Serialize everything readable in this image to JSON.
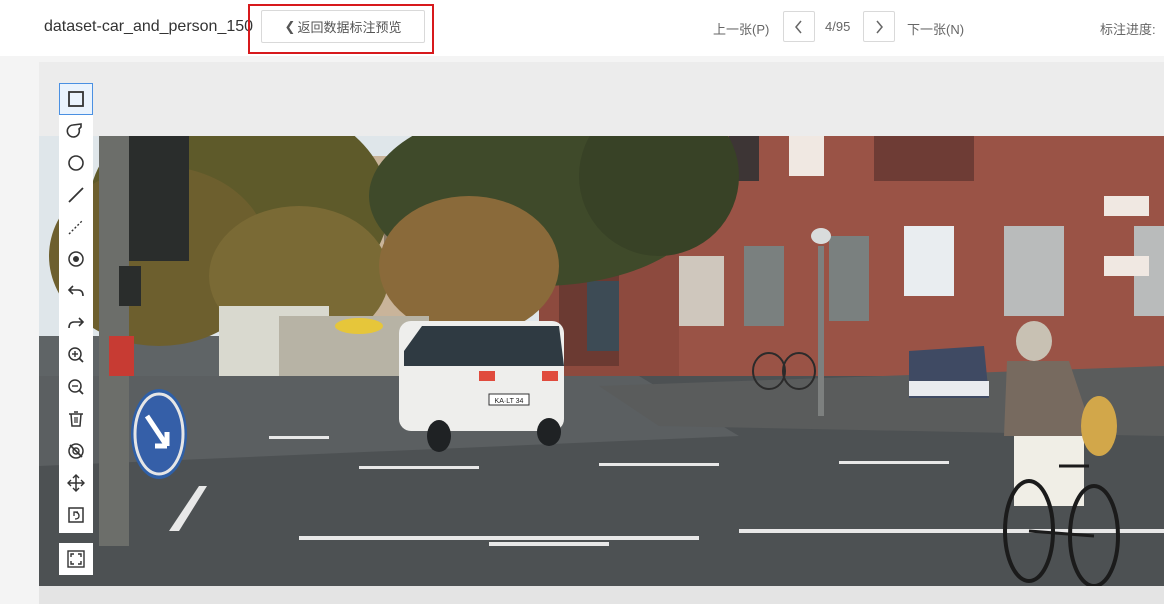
{
  "header": {
    "dataset_title": "dataset-car_and_person_150",
    "back_button_label": "返回数据标注预览",
    "prev_label": "上一张(P)",
    "next_label": "下一张(N)",
    "page_indicator": "4/95",
    "progress_label": "标注进度:"
  },
  "toolbar": {
    "tools": [
      {
        "name": "rectangle-tool",
        "icon": "square-icon",
        "active": true
      },
      {
        "name": "polygon-tool",
        "icon": "polygon-icon"
      },
      {
        "name": "circle-tool",
        "icon": "circle-icon"
      },
      {
        "name": "line-tool",
        "icon": "line-icon"
      },
      {
        "name": "dashed-line-tool",
        "icon": "dashed-line-icon"
      },
      {
        "name": "point-tool",
        "icon": "point-icon"
      },
      {
        "name": "undo-tool",
        "icon": "undo-icon"
      },
      {
        "name": "redo-tool",
        "icon": "redo-icon"
      },
      {
        "name": "zoom-in-tool",
        "icon": "zoom-in-icon"
      },
      {
        "name": "zoom-out-tool",
        "icon": "zoom-out-icon"
      },
      {
        "name": "delete-tool",
        "icon": "trash-icon"
      },
      {
        "name": "hide-tool",
        "icon": "eye-off-icon"
      },
      {
        "name": "move-tool",
        "icon": "move-icon"
      },
      {
        "name": "reset-tool",
        "icon": "reset-icon"
      }
    ],
    "fit_tool": {
      "name": "fit-screen-tool",
      "icon": "fullscreen-icon"
    }
  },
  "image": {
    "van_plate": "KA·LT 34",
    "description_free": true
  },
  "colors": {
    "highlight": "#d7191c",
    "active_tool": "#4a90e2"
  }
}
